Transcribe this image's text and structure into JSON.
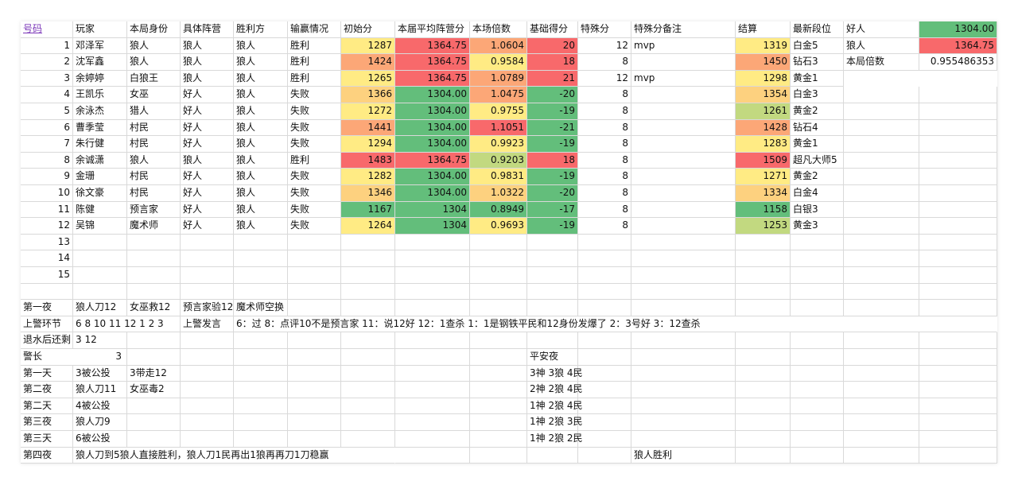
{
  "colors": {
    "green": "#63be7b",
    "light_green": "#c2d980",
    "yellow": "#ffeb84",
    "light_orange": "#fdd17f",
    "orange": "#fca777",
    "red": "#f8696b",
    "header_link": "#7a35b8"
  },
  "headers": [
    "号码",
    "玩家",
    "本局身份",
    "具体阵营",
    "胜利方",
    "输赢情况",
    "初始分",
    "本届平均阵营分",
    "本场倍数",
    "基础得分",
    "特殊分",
    "特殊分备注",
    "结算",
    "最新段位"
  ],
  "side_summary": [
    {
      "label": "好人",
      "value": "1304.00"
    },
    {
      "label": "狼人",
      "value": "1364.75"
    },
    {
      "label": "本局倍数",
      "value": "0.955486353"
    }
  ],
  "players": [
    {
      "no": "1",
      "name": "邓泽军",
      "role": "狼人",
      "camp": "狼人",
      "winner": "狼人",
      "result": "胜利",
      "init": "1287",
      "avg": "1364.75",
      "mult": "1.0604",
      "base": "20",
      "special": "12",
      "note": "mvp",
      "settle": "1319",
      "rank": "白金5"
    },
    {
      "no": "2",
      "name": "沈军鑫",
      "role": "狼人",
      "camp": "狼人",
      "winner": "狼人",
      "result": "胜利",
      "init": "1424",
      "avg": "1364.75",
      "mult": "0.9584",
      "base": "18",
      "special": "8",
      "note": "",
      "settle": "1450",
      "rank": "钻石3"
    },
    {
      "no": "3",
      "name": "余婷婷",
      "role": "白狼王",
      "camp": "狼人",
      "winner": "狼人",
      "result": "胜利",
      "init": "1265",
      "avg": "1364.75",
      "mult": "1.0789",
      "base": "21",
      "special": "12",
      "note": "mvp",
      "settle": "1298",
      "rank": "黄金1"
    },
    {
      "no": "4",
      "name": "王凯乐",
      "role": "女巫",
      "camp": "好人",
      "winner": "狼人",
      "result": "失败",
      "init": "1366",
      "avg": "1304.00",
      "mult": "1.0475",
      "base": "-20",
      "special": "8",
      "note": "",
      "settle": "1354",
      "rank": "白金3"
    },
    {
      "no": "5",
      "name": "余泳杰",
      "role": "猎人",
      "camp": "好人",
      "winner": "狼人",
      "result": "失败",
      "init": "1272",
      "avg": "1304.00",
      "mult": "0.9755",
      "base": "-19",
      "special": "8",
      "note": "",
      "settle": "1261",
      "rank": "黄金2"
    },
    {
      "no": "6",
      "name": "曹季莹",
      "role": "村民",
      "camp": "好人",
      "winner": "狼人",
      "result": "失败",
      "init": "1441",
      "avg": "1304.00",
      "mult": "1.1051",
      "base": "-21",
      "special": "8",
      "note": "",
      "settle": "1428",
      "rank": "钻石4"
    },
    {
      "no": "7",
      "name": "朱行健",
      "role": "村民",
      "camp": "好人",
      "winner": "狼人",
      "result": "失败",
      "init": "1294",
      "avg": "1304.00",
      "mult": "0.9923",
      "base": "-19",
      "special": "8",
      "note": "",
      "settle": "1283",
      "rank": "黄金1"
    },
    {
      "no": "8",
      "name": "余诚潇",
      "role": "狼人",
      "camp": "狼人",
      "winner": "狼人",
      "result": "胜利",
      "init": "1483",
      "avg": "1364.75",
      "mult": "0.9203",
      "base": "18",
      "special": "8",
      "note": "",
      "settle": "1509",
      "rank": "超凡大师5"
    },
    {
      "no": "9",
      "name": "金珊",
      "role": "村民",
      "camp": "好人",
      "winner": "狼人",
      "result": "失败",
      "init": "1282",
      "avg": "1304.00",
      "mult": "0.9831",
      "base": "-19",
      "special": "8",
      "note": "",
      "settle": "1271",
      "rank": "黄金2"
    },
    {
      "no": "10",
      "name": "徐文豪",
      "role": "村民",
      "camp": "好人",
      "winner": "狼人",
      "result": "失败",
      "init": "1346",
      "avg": "1304.00",
      "mult": "1.0322",
      "base": "-20",
      "special": "8",
      "note": "",
      "settle": "1334",
      "rank": "白金4"
    },
    {
      "no": "11",
      "name": "陈健",
      "role": "预言家",
      "camp": "好人",
      "winner": "狼人",
      "result": "失败",
      "init": "1167",
      "avg": "1304",
      "mult": "0.8949",
      "base": "-17",
      "special": "8",
      "note": "",
      "settle": "1158",
      "rank": "白银3"
    },
    {
      "no": "12",
      "name": "吴锦",
      "role": "魔术师",
      "camp": "好人",
      "winner": "狼人",
      "result": "失败",
      "init": "1264",
      "avg": "1304",
      "mult": "0.9693",
      "base": "-19",
      "special": "8",
      "note": "",
      "settle": "1253",
      "rank": "黄金3"
    }
  ],
  "empty_numbers": [
    "13",
    "14",
    "15"
  ],
  "log": {
    "night1": {
      "label": "第一夜",
      "items": [
        "狼人刀12",
        "女巫救12",
        "预言家验12",
        "魔术师空换"
      ]
    },
    "sheriff_round": {
      "label": "上警环节",
      "seats": "6 8 10 11 12 1 2 3",
      "speech_label": "上警发言",
      "speech": "6：过 8：点评10不是预言家 11：说12好 12：1查杀 1：1是钢铁平民和12身份发爆了 2：3号好 3：12查杀"
    },
    "withdraw": {
      "label": "退水后还剩",
      "value": "3 12"
    },
    "sheriff": {
      "label": "警长",
      "value": "3",
      "status": "平安夜"
    },
    "phases": [
      {
        "label": "第一天",
        "a": "3被公投",
        "b": "3带走12",
        "status": "3神 3狼 4民"
      },
      {
        "label": "第二夜",
        "a": "狼人刀11",
        "b": "女巫毒2",
        "status": "2神 2狼 4民"
      },
      {
        "label": "第二天",
        "a": "4被公投",
        "b": "",
        "status": "1神 2狼 4民"
      },
      {
        "label": "第三夜",
        "a": "狼人刀9",
        "b": "",
        "status": "1神 2狼 3民"
      },
      {
        "label": "第三天",
        "a": "6被公投",
        "b": "",
        "status": "1神 2狼 2民"
      }
    ],
    "night4": {
      "label": "第四夜",
      "text": "狼人刀到5狼人直接胜利，狼人刀1民再出1狼再再刀1刀稳赢",
      "result": "狼人胜利"
    }
  }
}
